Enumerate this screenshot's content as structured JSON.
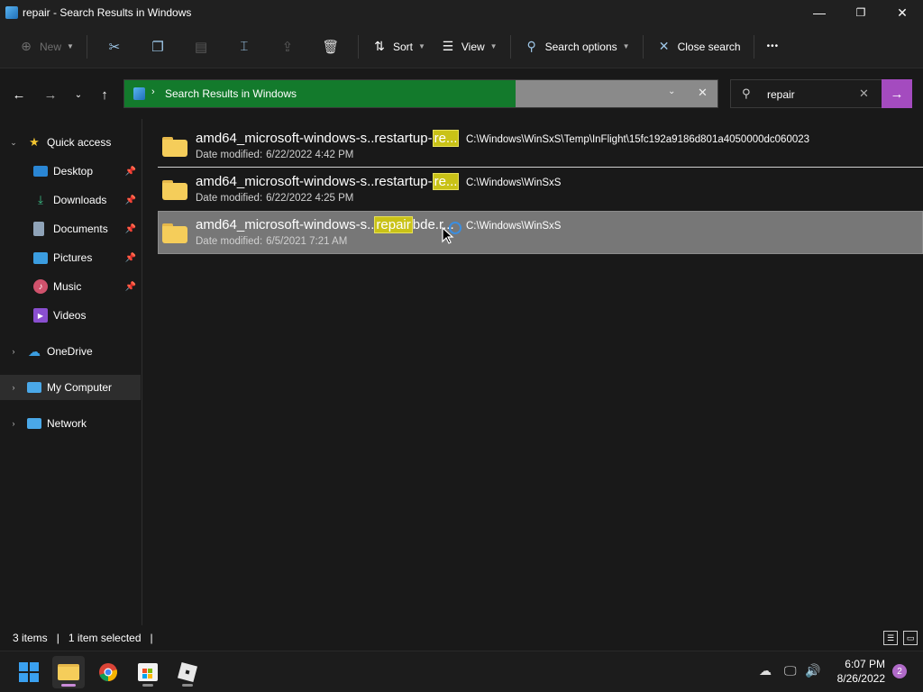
{
  "window": {
    "title": "repair - Search Results in Windows",
    "minimize_glyph": "—",
    "restore_glyph": "❐",
    "close_glyph": "✕"
  },
  "toolbar": {
    "new_label": "New",
    "sort_label": "Sort",
    "view_label": "View",
    "search_options_label": "Search options",
    "close_search_label": "Close search",
    "more_glyph": "•••"
  },
  "address": {
    "location": "Search Results in Windows",
    "progress_fraction": 0.66
  },
  "search": {
    "query": "repair"
  },
  "sidebar": {
    "items": [
      {
        "label": "Quick access",
        "icon": "star-icon"
      },
      {
        "label": "Desktop",
        "icon": "desktop-icon"
      },
      {
        "label": "Downloads",
        "icon": "download-icon"
      },
      {
        "label": "Documents",
        "icon": "document-icon"
      },
      {
        "label": "Pictures",
        "icon": "pictures-icon"
      },
      {
        "label": "Music",
        "icon": "music-icon"
      },
      {
        "label": "Videos",
        "icon": "video-icon"
      },
      {
        "label": "OneDrive",
        "icon": "cloud-icon"
      },
      {
        "label": "My Computer",
        "icon": "computer-icon"
      },
      {
        "label": "Network",
        "icon": "network-icon"
      }
    ]
  },
  "results": [
    {
      "name_prefix": "amd64_microsoft-windows-s..restartup-",
      "name_highlight": "re...",
      "name_suffix": "",
      "date_label": "Date modified:",
      "date": "6/22/2022 4:42 PM",
      "path": "C:\\Windows\\WinSxS\\Temp\\InFlight\\15fc192a9186d801a4050000dc060023"
    },
    {
      "name_prefix": "amd64_microsoft-windows-s..restartup-",
      "name_highlight": "re...",
      "name_suffix": "",
      "date_label": "Date modified:",
      "date": "6/22/2022 4:25 PM",
      "path": "C:\\Windows\\WinSxS"
    },
    {
      "name_prefix": "amd64_microsoft-windows-s..",
      "name_highlight": "repair",
      "name_suffix": "bde.r...",
      "date_label": "Date modified:",
      "date": "6/5/2021 7:21 AM",
      "path": "C:\\Windows\\WinSxS"
    }
  ],
  "status": {
    "items_count": "3 items",
    "selected_count": "1 item selected"
  },
  "taskbar": {
    "time": "6:07 PM",
    "date": "8/26/2022",
    "notification_count": "2"
  },
  "colors": {
    "address_progress": "#137a2c",
    "search_go": "#a44bbf",
    "highlight": "#c9c217"
  }
}
